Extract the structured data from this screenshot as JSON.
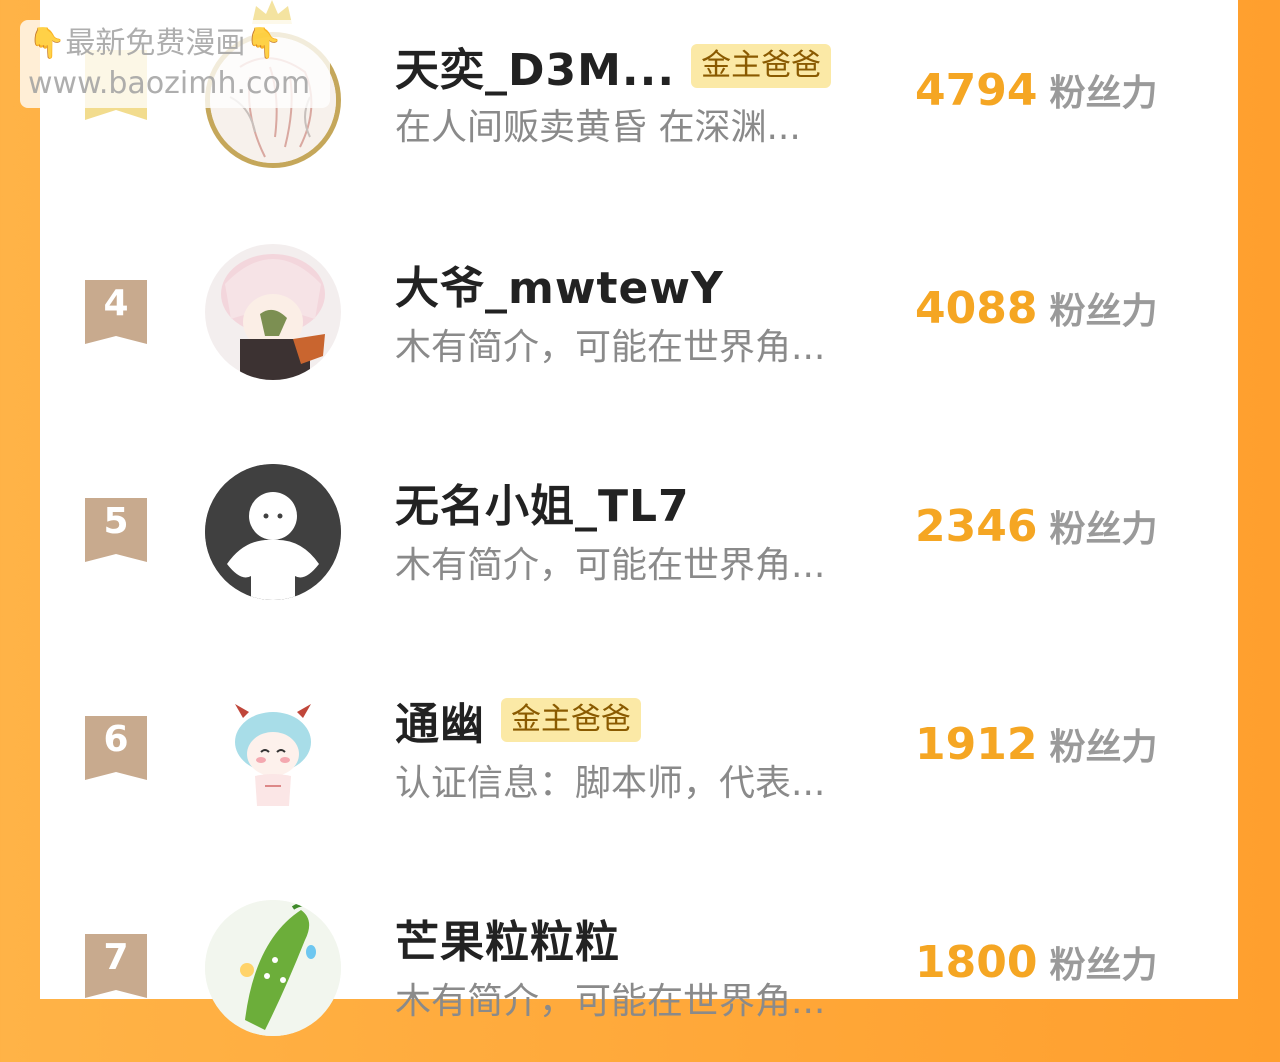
{
  "watermark": {
    "line1": "👇最新免费漫画👇",
    "line2": "www.baozimh.com"
  },
  "rows": [
    {
      "rank": "3",
      "name": "天奕_D3M...",
      "tag": "金主爸爸",
      "bio": "在人间贩卖黄昏 在深渊...",
      "fans_num": "4794",
      "fans_label": "粉丝力"
    },
    {
      "rank": "4",
      "name": "大爷_mwtewY",
      "tag": "",
      "bio": "木有简介，可能在世界角...",
      "fans_num": "4088",
      "fans_label": "粉丝力"
    },
    {
      "rank": "5",
      "name": "无名小姐_TL7",
      "tag": "",
      "bio": "木有简介，可能在世界角...",
      "fans_num": "2346",
      "fans_label": "粉丝力"
    },
    {
      "rank": "6",
      "name": "通幽",
      "tag": "金主爸爸",
      "bio": "认证信息：脚本师，代表...",
      "fans_num": "1912",
      "fans_label": "粉丝力"
    },
    {
      "rank": "7",
      "name": "芒果粒粒粒",
      "tag": "",
      "bio": "木有简介，可能在世界角...",
      "fans_num": "1800",
      "fans_label": "粉丝力"
    }
  ],
  "colors": {
    "background": "#ff9f2e",
    "fans_number": "#f5a623",
    "rank_badge": "#c8aa8e",
    "vip_tag_bg": "#fbe9a6"
  }
}
